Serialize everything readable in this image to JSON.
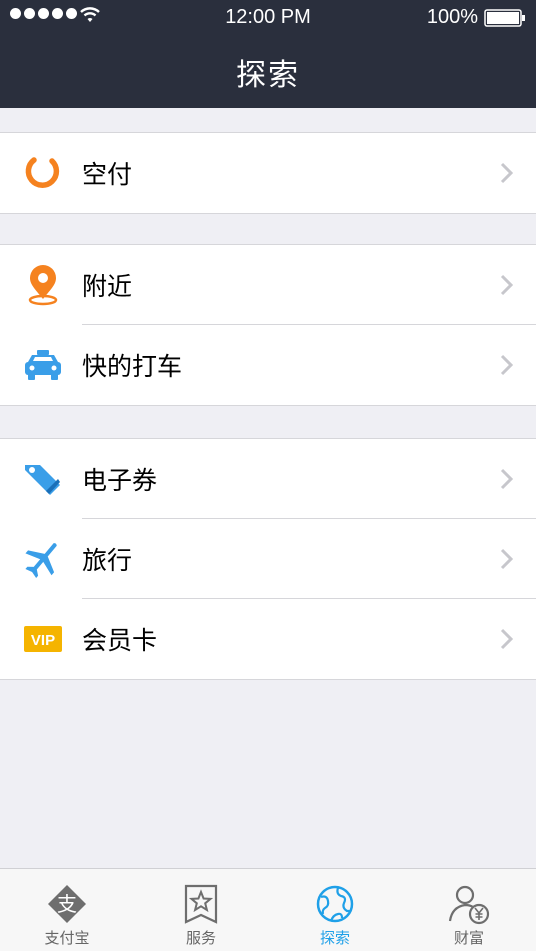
{
  "status_bar": {
    "time": "12:00 PM",
    "battery": "100%"
  },
  "header": {
    "title": "探索"
  },
  "groups": [
    {
      "items": [
        {
          "label": "空付",
          "icon": "kongfu-ring-icon"
        }
      ]
    },
    {
      "items": [
        {
          "label": "附近",
          "icon": "location-pin-icon"
        },
        {
          "label": "快的打车",
          "icon": "taxi-icon"
        }
      ]
    },
    {
      "items": [
        {
          "label": "电子券",
          "icon": "coupon-tag-icon"
        },
        {
          "label": "旅行",
          "icon": "airplane-icon"
        },
        {
          "label": "会员卡",
          "icon": "vip-card-icon",
          "icon_text": "VIP"
        }
      ]
    }
  ],
  "tabbar": {
    "tabs": [
      {
        "label": "支付宝",
        "icon": "alipay-icon"
      },
      {
        "label": "服务",
        "icon": "star-bookmark-icon"
      },
      {
        "label": "探索",
        "icon": "globe-icon",
        "active": true
      },
      {
        "label": "财富",
        "icon": "user-yen-icon"
      }
    ],
    "alipay_glyph": "支"
  },
  "colors": {
    "header_bg": "#2a2f3d",
    "page_bg": "#efeff4",
    "active_tab": "#1fa0e8",
    "orange": "#f5821f",
    "blue": "#3a9ee8",
    "vip_yellow": "#f5b400"
  }
}
